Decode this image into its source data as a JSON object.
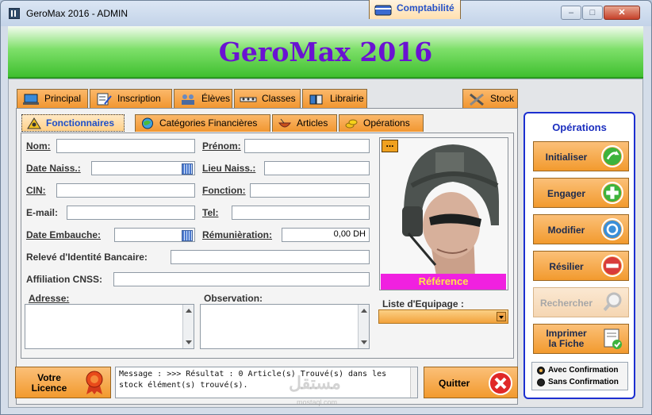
{
  "window": {
    "title": "GeroMax 2016  -  ADMIN",
    "min": "–",
    "max": "□",
    "close": "✕"
  },
  "banner": {
    "title": "GeroMax 2016"
  },
  "main_tabs": [
    {
      "label": "Principal"
    },
    {
      "label": "Inscription"
    },
    {
      "label": "Élèves"
    },
    {
      "label": "Classes"
    },
    {
      "label": "Librairie"
    },
    {
      "label": "Comptabilité"
    },
    {
      "label": "Stock"
    }
  ],
  "sub_tabs": [
    {
      "label": "Fonctionnaires"
    },
    {
      "label": "Catégories Financières"
    },
    {
      "label": "Articles"
    },
    {
      "label": "Opérations"
    }
  ],
  "form": {
    "nom": "Nom:",
    "prenom": "Prénom:",
    "date_naiss": "Date Naiss.:",
    "lieu_naiss": "Lieu Naiss.:",
    "cin": "CIN:",
    "fonction": "Fonction:",
    "email": "E-mail:",
    "tel": "Tel:",
    "date_embauche": "Date Embauche:",
    "remuneration": "Rémunièration:",
    "remuneration_value": "0,00 DH",
    "rib": "Relevé d'Identité Bancaire:",
    "cnss": "Affiliation CNSS:",
    "adresse": "Adresse:",
    "observation": "Observation:"
  },
  "photo": {
    "dots": "...",
    "reference": "Référence"
  },
  "equipage": {
    "label": "Liste d'Equipage :"
  },
  "operations": {
    "title": "Opérations",
    "buttons": [
      {
        "label": "Initialiser",
        "icon": "arrow-icon",
        "color": "#3db33d"
      },
      {
        "label": "Engager",
        "icon": "plus-icon",
        "color": "#3db33d"
      },
      {
        "label": "Modifier",
        "icon": "refresh-icon",
        "color": "#3b8fd8"
      },
      {
        "label": "Résilier",
        "icon": "minus-icon",
        "color": "#d83b3b"
      },
      {
        "label": "Rechercher",
        "icon": "magnifier-icon",
        "color": "#bdbdbd"
      },
      {
        "label_line1": "Imprimer",
        "label_line2": "la Fiche",
        "icon": "document-check-icon",
        "color": "#3db33d"
      }
    ],
    "radio_with": "Avec Confirmation",
    "radio_without": "Sans Confirmation"
  },
  "footer": {
    "licence_line1": "Votre",
    "licence_line2": "Licence",
    "message": "Message : >>> Résultat : 0 Article(s) Trouvé(s) dans les stock élément(s) trouvé(s).",
    "quit": "Quitter"
  },
  "watermark": {
    "text": "مستقل",
    "sub": "mostaql.com"
  }
}
